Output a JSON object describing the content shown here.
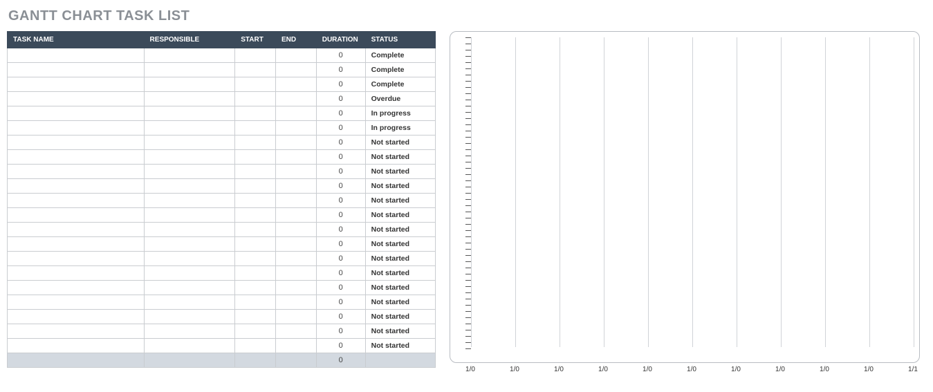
{
  "title": "GANTT CHART TASK LIST",
  "columns": {
    "task": "TASK NAME",
    "responsible": "RESPONSIBLE",
    "start": "START",
    "end": "END",
    "duration": "DURATION",
    "status": "STATUS"
  },
  "rows": [
    {
      "task": "",
      "responsible": "",
      "start": "",
      "end": "",
      "duration": "0",
      "status": "Complete"
    },
    {
      "task": "",
      "responsible": "",
      "start": "",
      "end": "",
      "duration": "0",
      "status": "Complete"
    },
    {
      "task": "",
      "responsible": "",
      "start": "",
      "end": "",
      "duration": "0",
      "status": "Complete"
    },
    {
      "task": "",
      "responsible": "",
      "start": "",
      "end": "",
      "duration": "0",
      "status": "Overdue"
    },
    {
      "task": "",
      "responsible": "",
      "start": "",
      "end": "",
      "duration": "0",
      "status": "In progress"
    },
    {
      "task": "",
      "responsible": "",
      "start": "",
      "end": "",
      "duration": "0",
      "status": "In progress"
    },
    {
      "task": "",
      "responsible": "",
      "start": "",
      "end": "",
      "duration": "0",
      "status": "Not started"
    },
    {
      "task": "",
      "responsible": "",
      "start": "",
      "end": "",
      "duration": "0",
      "status": "Not started"
    },
    {
      "task": "",
      "responsible": "",
      "start": "",
      "end": "",
      "duration": "0",
      "status": "Not started"
    },
    {
      "task": "",
      "responsible": "",
      "start": "",
      "end": "",
      "duration": "0",
      "status": "Not started"
    },
    {
      "task": "",
      "responsible": "",
      "start": "",
      "end": "",
      "duration": "0",
      "status": "Not started"
    },
    {
      "task": "",
      "responsible": "",
      "start": "",
      "end": "",
      "duration": "0",
      "status": "Not started"
    },
    {
      "task": "",
      "responsible": "",
      "start": "",
      "end": "",
      "duration": "0",
      "status": "Not started"
    },
    {
      "task": "",
      "responsible": "",
      "start": "",
      "end": "",
      "duration": "0",
      "status": "Not started"
    },
    {
      "task": "",
      "responsible": "",
      "start": "",
      "end": "",
      "duration": "0",
      "status": "Not started"
    },
    {
      "task": "",
      "responsible": "",
      "start": "",
      "end": "",
      "duration": "0",
      "status": "Not started"
    },
    {
      "task": "",
      "responsible": "",
      "start": "",
      "end": "",
      "duration": "0",
      "status": "Not started"
    },
    {
      "task": "",
      "responsible": "",
      "start": "",
      "end": "",
      "duration": "0",
      "status": "Not started"
    },
    {
      "task": "",
      "responsible": "",
      "start": "",
      "end": "",
      "duration": "0",
      "status": "Not started"
    },
    {
      "task": "",
      "responsible": "",
      "start": "",
      "end": "",
      "duration": "0",
      "status": "Not started"
    },
    {
      "task": "",
      "responsible": "",
      "start": "",
      "end": "",
      "duration": "0",
      "status": "Not started"
    }
  ],
  "footer": {
    "duration": "0"
  },
  "chart_data": {
    "type": "bar",
    "title": "",
    "xlabel": "",
    "ylabel": "",
    "x_ticks": [
      "1/0",
      "1/0",
      "1/0",
      "1/0",
      "1/0",
      "1/0",
      "1/0",
      "1/0",
      "1/0",
      "1/0",
      "1/1"
    ],
    "y_tick_count": 50,
    "series": [],
    "notes": "empty gantt timeline — no bars present"
  }
}
